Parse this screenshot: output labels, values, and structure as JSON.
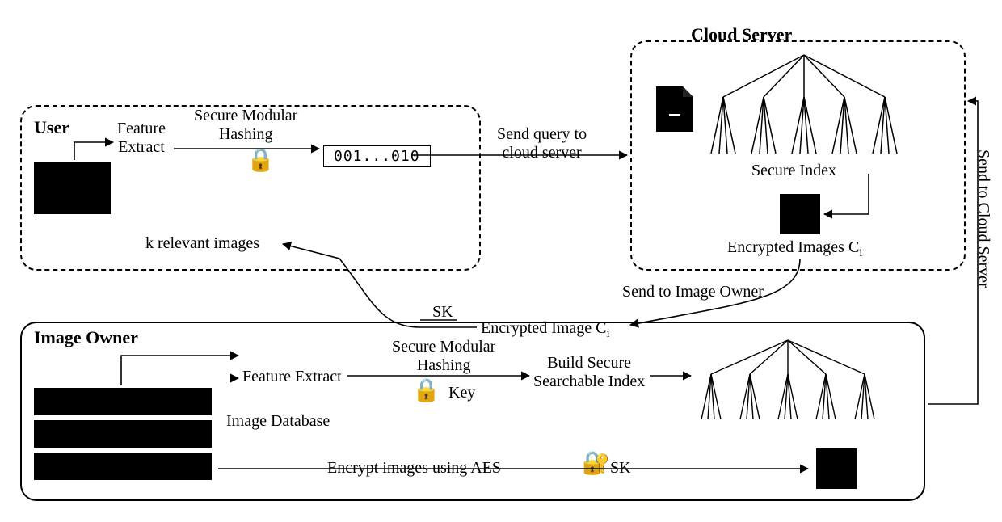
{
  "user": {
    "title": "User",
    "feature_extract": "Feature\nExtract",
    "secure_hashing": "Secure Modular\nHashing",
    "hash_code": "001...010",
    "k_relevant": "k relevant images"
  },
  "cloud": {
    "title": "Cloud Server",
    "secure_index": "Secure Index",
    "enc_images": "Encrypted Images C",
    "enc_images_sub": "i"
  },
  "owner": {
    "title": "Image Owner",
    "feature_extract": "Feature Extract",
    "secure_hashing": "Secure Modular\nHashing",
    "key": "Key",
    "build_index": "Build Secure\nSearchable Index",
    "encrypt_aes": "Encrypt images using AES",
    "sk": "SK",
    "image_db": "Image Database"
  },
  "flows": {
    "send_query": "Send query to\ncloud server",
    "send_to_owner": "Send to Image Owner",
    "enc_image_ci": "Encrypted Image C",
    "enc_image_ci_sub": "i",
    "sk_flow": "SK",
    "send_to_cloud": "Send to Cloud Server"
  }
}
